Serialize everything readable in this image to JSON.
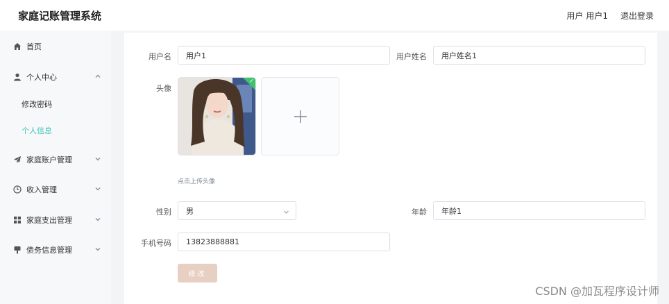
{
  "header": {
    "app_title": "家庭记账管理系统",
    "user_role": "用户",
    "user_name": "用户1",
    "logout_label": "退出登录"
  },
  "sidebar": {
    "items": [
      {
        "label": "首页",
        "icon": "home-icon"
      },
      {
        "label": "个人中心",
        "icon": "user-icon",
        "expanded": true,
        "children": [
          {
            "label": "修改密码"
          },
          {
            "label": "个人信息",
            "active": true
          }
        ]
      },
      {
        "label": "家庭账户管理",
        "icon": "paper-plane-icon"
      },
      {
        "label": "收入管理",
        "icon": "clock-icon"
      },
      {
        "label": "家庭支出管理",
        "icon": "grid-icon"
      },
      {
        "label": "债务信息管理",
        "icon": "pin-icon"
      }
    ]
  },
  "form": {
    "username_label": "用户名",
    "username_value": "用户1",
    "fullname_label": "用户姓名",
    "fullname_value": "用户姓名1",
    "avatar_label": "头像",
    "avatar_hint": "点击上传头像",
    "gender_label": "性别",
    "gender_value": "男",
    "age_label": "年龄",
    "age_value": "年龄1",
    "phone_label": "手机号码",
    "phone_value": "13823888881",
    "submit_label": "修改"
  },
  "watermark": "CSDN @加瓦程序设计师",
  "colors": {
    "accent": "#3ec7b9",
    "submit_bg": "#e8cfc3",
    "upload_check": "#3ec46d"
  }
}
